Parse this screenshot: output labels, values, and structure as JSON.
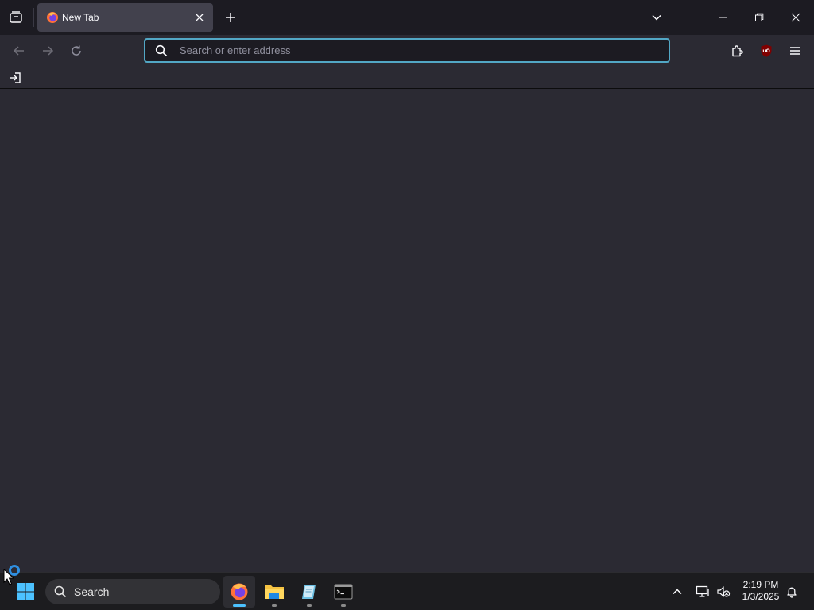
{
  "tabs": [
    {
      "title": "New Tab",
      "favicon": "firefox-icon",
      "active": true
    }
  ],
  "urlbar": {
    "value": "",
    "placeholder": "Search or enter address"
  },
  "taskbar": {
    "search_label": "Search",
    "apps": [
      "firefox",
      "file-explorer",
      "notepad",
      "terminal"
    ],
    "active_app": "firefox"
  },
  "clock": {
    "time": "2:19 PM",
    "date": "1/3/2025"
  },
  "colors": {
    "chrome_bg": "#1c1b22",
    "toolbar_bg": "#2b2a33",
    "tab_active": "#42414d",
    "focus_ring": "#52a7c5",
    "taskbar_bg": "#1c1c1f"
  },
  "extensions": [
    "extensions-puzzle-icon",
    "ublock-origin-icon"
  ]
}
